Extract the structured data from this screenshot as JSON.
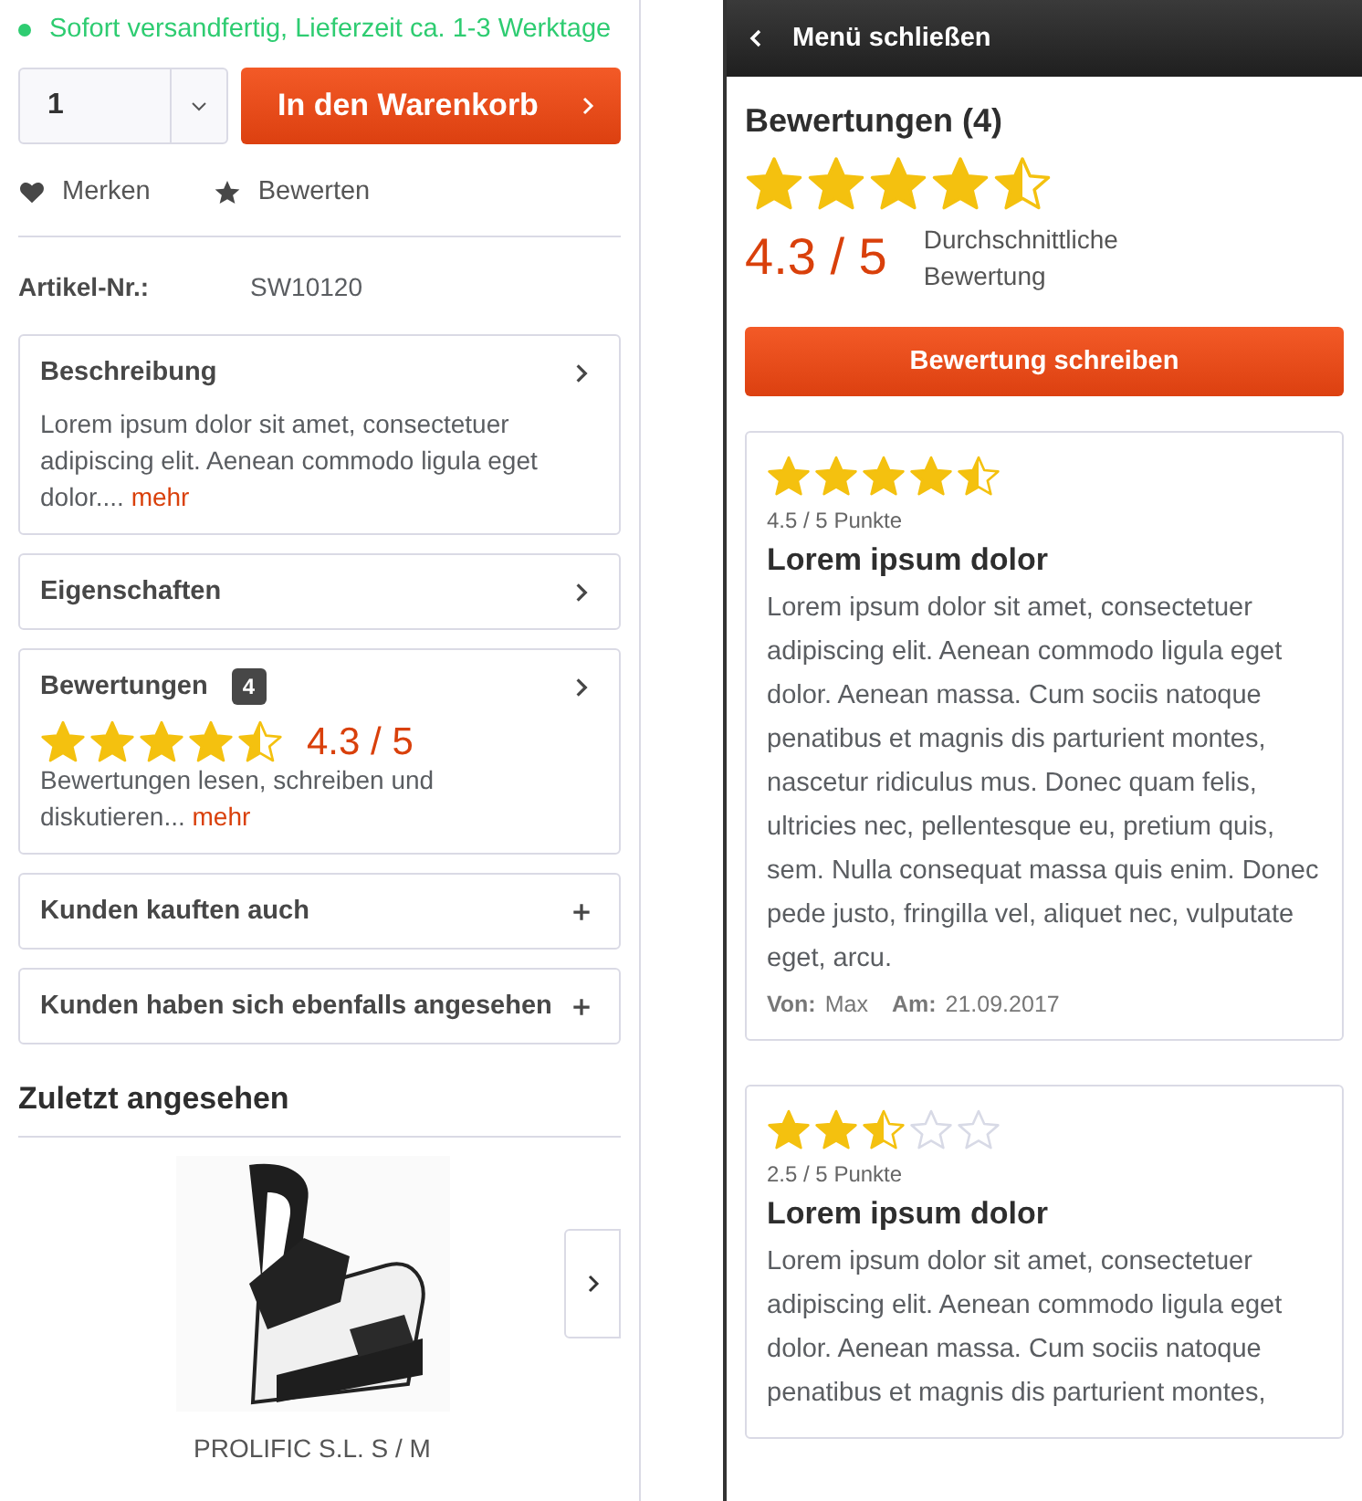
{
  "status": {
    "text": "Sofort versandfertig, Lieferzeit ca. 1-3 Werktage"
  },
  "quantity": {
    "value": "1"
  },
  "cart_button": {
    "label": "In den Warenkorb"
  },
  "actions": [
    {
      "kind": "heart",
      "label": "Merken"
    },
    {
      "kind": "star",
      "label": "Bewerten"
    }
  ],
  "article_number": {
    "label": "Artikel-Nr.:",
    "value": "SW10120"
  },
  "sections": [
    {
      "kind": "text",
      "title": "Beschreibung",
      "text": "Lorem ipsum dolor sit amet, consectetuer adipiscing elit. Aenean commodo ligula eget dolor....",
      "link": "mehr"
    },
    {
      "kind": "plain",
      "title": "Eigenschaften"
    },
    {
      "kind": "rating",
      "title": "Bewertungen",
      "badge": "4",
      "stars": 4.5,
      "score": "4.3 / 5",
      "text": "Bewertungen lesen, schreiben und diskutieren...",
      "link": "mehr"
    },
    {
      "kind": "expandable",
      "title": "Kunden kauften auch"
    },
    {
      "kind": "expandable",
      "title": "Kunden haben sich ebenfalls angesehen"
    }
  ],
  "recently_viewed": {
    "title": "Zuletzt angesehen",
    "products": [
      {
        "name": "PROLIFIC S.L. S / M"
      }
    ]
  },
  "panel": {
    "close_label": "Menü schließen",
    "title": "Bewertungen (4)",
    "stars": 4.5,
    "score": "4.3 / 5",
    "score_caption": "Durchschnittliche Bewertung",
    "write_button": "Bewertung schreiben",
    "reviews": [
      {
        "stars": 4.5,
        "points": "4.5 / 5 Punkte",
        "title": "Lorem ipsum dolor",
        "text": "Lorem ipsum dolor sit amet, consectetuer adipiscing elit. Aenean commodo ligula eget dolor. Aenean massa. Cum sociis natoque penatibus et magnis dis parturient montes, nascetur ridiculus mus. Donec quam felis, ultricies nec, pellentesque eu, pretium quis, sem. Nulla consequat massa quis enim. Donec pede justo, fringilla vel, aliquet nec, vulputate eget, arcu.",
        "author_label": "Von:",
        "author": "Max",
        "date_label": "Am:",
        "date": "21.09.2017"
      },
      {
        "stars": 2.5,
        "points": "2.5 / 5 Punkte",
        "title": "Lorem ipsum dolor",
        "text": "Lorem ipsum dolor sit amet, consectetuer adipiscing elit. Aenean commodo ligula eget dolor. Aenean massa. Cum sociis natoque penatibus et magnis dis parturient montes,"
      }
    ]
  }
}
